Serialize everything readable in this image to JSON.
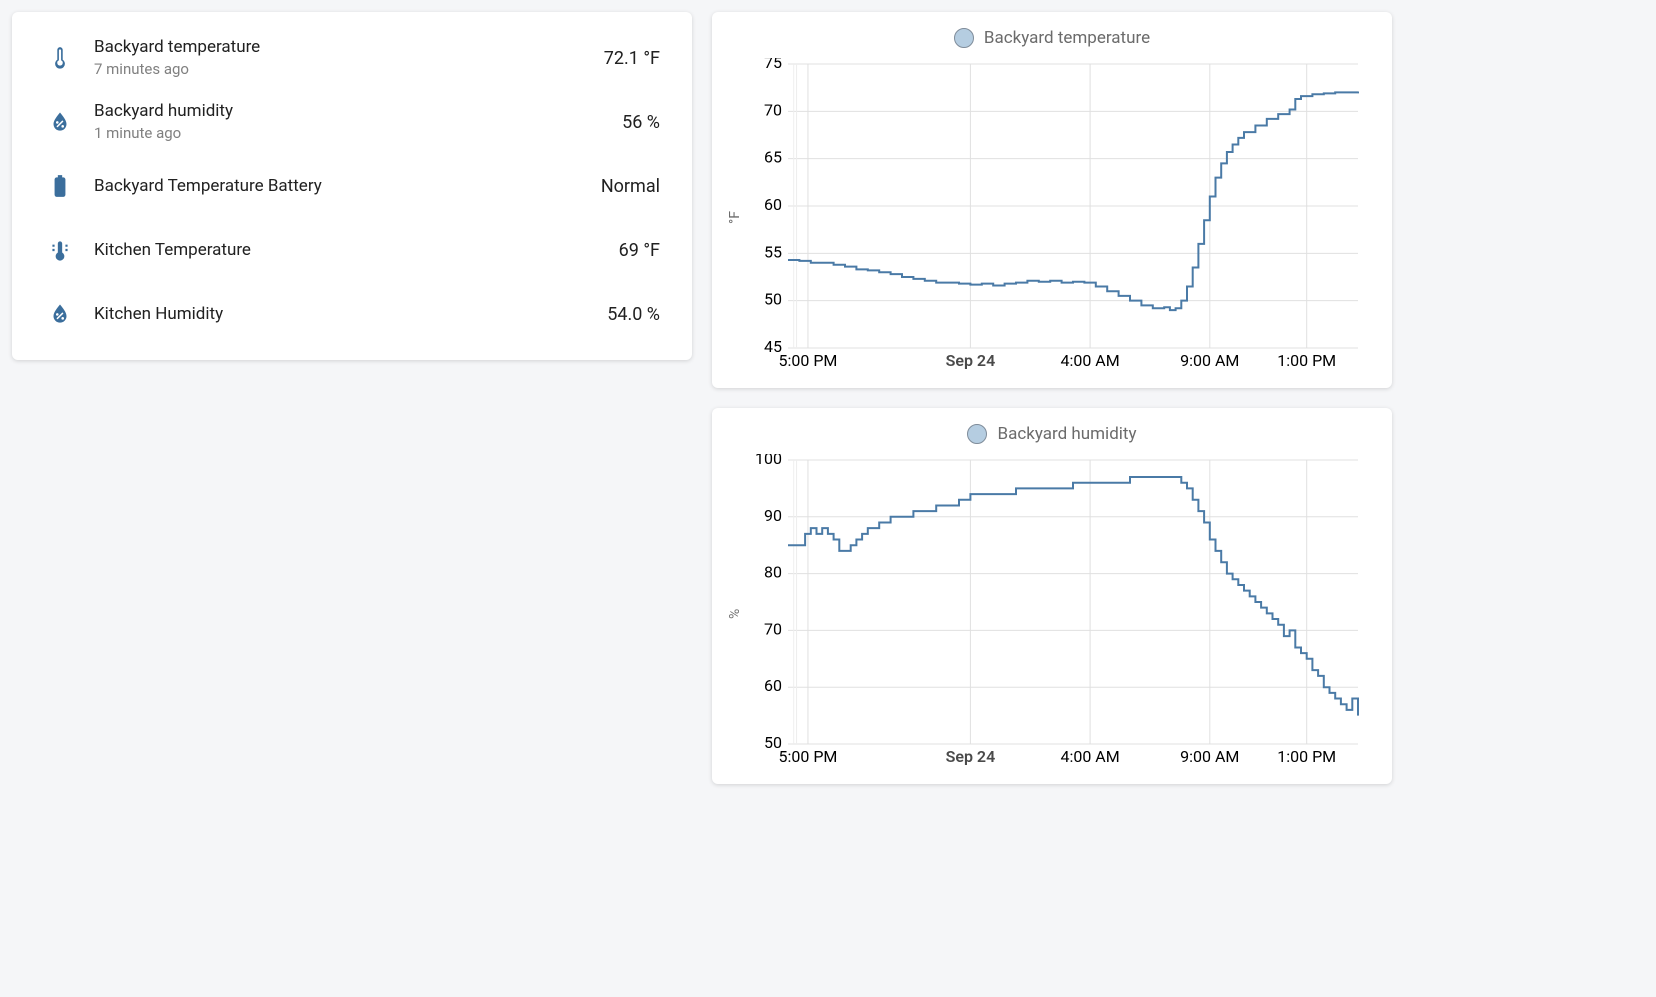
{
  "sensors": {
    "items": [
      {
        "icon": "thermometer",
        "name": "Backyard temperature",
        "sub": "7 minutes ago",
        "value": "72.1 °F"
      },
      {
        "icon": "humidity",
        "name": "Backyard humidity",
        "sub": "1 minute ago",
        "value": "56 %"
      },
      {
        "icon": "battery",
        "name": "Backyard Temperature Battery",
        "sub": "",
        "value": "Normal"
      },
      {
        "icon": "thermostat",
        "name": "Kitchen Temperature",
        "sub": "",
        "value": "69 °F"
      },
      {
        "icon": "humidity",
        "name": "Kitchen Humidity",
        "sub": "",
        "value": "54.0 %"
      }
    ]
  },
  "charts": {
    "temp": {
      "legend": "Backyard temperature",
      "ylabel": "°F"
    },
    "hum": {
      "legend": "Backyard humidity",
      "ylabel": "%"
    }
  },
  "chart_data": [
    {
      "type": "line",
      "title": "Backyard temperature",
      "ylabel": "°F",
      "xlabel": "",
      "ylim": [
        45,
        75
      ],
      "yticks": [
        45,
        50,
        55,
        60,
        65,
        70,
        75
      ],
      "xticks": [
        "5:00 PM",
        "Sep 24",
        "4:00 AM",
        "9:00 AM",
        "1:00 PM"
      ],
      "xtick_bold": [
        false,
        true,
        false,
        false,
        false
      ],
      "xtick_pos": [
        0.035,
        0.32,
        0.53,
        0.74,
        0.91
      ],
      "series": [
        {
          "name": "Backyard temperature",
          "points": [
            [
              0.0,
              54.3
            ],
            [
              0.02,
              54.2
            ],
            [
              0.04,
              54.0
            ],
            [
              0.07,
              54.0
            ],
            [
              0.08,
              53.8
            ],
            [
              0.1,
              53.6
            ],
            [
              0.12,
              53.3
            ],
            [
              0.14,
              53.2
            ],
            [
              0.16,
              53.0
            ],
            [
              0.18,
              52.8
            ],
            [
              0.2,
              52.5
            ],
            [
              0.22,
              52.3
            ],
            [
              0.24,
              52.1
            ],
            [
              0.26,
              51.9
            ],
            [
              0.28,
              51.9
            ],
            [
              0.3,
              51.8
            ],
            [
              0.32,
              51.7
            ],
            [
              0.34,
              51.8
            ],
            [
              0.36,
              51.6
            ],
            [
              0.38,
              51.8
            ],
            [
              0.4,
              51.9
            ],
            [
              0.42,
              52.1
            ],
            [
              0.44,
              52.0
            ],
            [
              0.46,
              52.1
            ],
            [
              0.48,
              51.9
            ],
            [
              0.5,
              52.0
            ],
            [
              0.52,
              51.9
            ],
            [
              0.54,
              51.5
            ],
            [
              0.56,
              51.0
            ],
            [
              0.58,
              50.5
            ],
            [
              0.6,
              50.0
            ],
            [
              0.62,
              49.5
            ],
            [
              0.64,
              49.2
            ],
            [
              0.66,
              49.3
            ],
            [
              0.67,
              49.0
            ],
            [
              0.68,
              49.2
            ],
            [
              0.69,
              50.0
            ],
            [
              0.7,
              51.5
            ],
            [
              0.71,
              53.5
            ],
            [
              0.72,
              56.0
            ],
            [
              0.73,
              58.5
            ],
            [
              0.74,
              61.0
            ],
            [
              0.75,
              63.0
            ],
            [
              0.76,
              64.5
            ],
            [
              0.77,
              65.7
            ],
            [
              0.78,
              66.5
            ],
            [
              0.79,
              67.2
            ],
            [
              0.8,
              67.8
            ],
            [
              0.82,
              68.5
            ],
            [
              0.84,
              69.2
            ],
            [
              0.86,
              69.7
            ],
            [
              0.88,
              70.2
            ],
            [
              0.89,
              71.3
            ],
            [
              0.9,
              71.6
            ],
            [
              0.92,
              71.8
            ],
            [
              0.94,
              71.9
            ],
            [
              0.96,
              72.0
            ],
            [
              0.98,
              72.0
            ],
            [
              1.0,
              72.1
            ]
          ]
        }
      ]
    },
    {
      "type": "line",
      "title": "Backyard humidity",
      "ylabel": "%",
      "xlabel": "",
      "ylim": [
        50,
        100
      ],
      "yticks": [
        50,
        60,
        70,
        80,
        90,
        100
      ],
      "xticks": [
        "5:00 PM",
        "Sep 24",
        "4:00 AM",
        "9:00 AM",
        "1:00 PM"
      ],
      "xtick_bold": [
        false,
        true,
        false,
        false,
        false
      ],
      "xtick_pos": [
        0.035,
        0.32,
        0.53,
        0.74,
        0.91
      ],
      "series": [
        {
          "name": "Backyard humidity",
          "points": [
            [
              0.0,
              85
            ],
            [
              0.02,
              85
            ],
            [
              0.03,
              87
            ],
            [
              0.04,
              88
            ],
            [
              0.05,
              87
            ],
            [
              0.06,
              88
            ],
            [
              0.07,
              87
            ],
            [
              0.08,
              86
            ],
            [
              0.09,
              84
            ],
            [
              0.1,
              84
            ],
            [
              0.11,
              85
            ],
            [
              0.12,
              86
            ],
            [
              0.13,
              87
            ],
            [
              0.14,
              88
            ],
            [
              0.16,
              89
            ],
            [
              0.18,
              90
            ],
            [
              0.2,
              90
            ],
            [
              0.22,
              91
            ],
            [
              0.24,
              91
            ],
            [
              0.26,
              92
            ],
            [
              0.28,
              92
            ],
            [
              0.3,
              93
            ],
            [
              0.32,
              94
            ],
            [
              0.34,
              94
            ],
            [
              0.36,
              94
            ],
            [
              0.38,
              94
            ],
            [
              0.4,
              95
            ],
            [
              0.42,
              95
            ],
            [
              0.44,
              95
            ],
            [
              0.46,
              95
            ],
            [
              0.48,
              95
            ],
            [
              0.5,
              96
            ],
            [
              0.52,
              96
            ],
            [
              0.54,
              96
            ],
            [
              0.56,
              96
            ],
            [
              0.58,
              96
            ],
            [
              0.6,
              97
            ],
            [
              0.62,
              97
            ],
            [
              0.64,
              97
            ],
            [
              0.66,
              97
            ],
            [
              0.68,
              97
            ],
            [
              0.69,
              96
            ],
            [
              0.7,
              95
            ],
            [
              0.71,
              93
            ],
            [
              0.72,
              91
            ],
            [
              0.73,
              89
            ],
            [
              0.74,
              86
            ],
            [
              0.75,
              84
            ],
            [
              0.76,
              82
            ],
            [
              0.77,
              80
            ],
            [
              0.78,
              79
            ],
            [
              0.79,
              78
            ],
            [
              0.8,
              77
            ],
            [
              0.81,
              76
            ],
            [
              0.82,
              75
            ],
            [
              0.83,
              74
            ],
            [
              0.84,
              73
            ],
            [
              0.85,
              72
            ],
            [
              0.86,
              71
            ],
            [
              0.87,
              69
            ],
            [
              0.88,
              70
            ],
            [
              0.89,
              67
            ],
            [
              0.9,
              66
            ],
            [
              0.91,
              65
            ],
            [
              0.92,
              63
            ],
            [
              0.93,
              62
            ],
            [
              0.94,
              60
            ],
            [
              0.95,
              59
            ],
            [
              0.96,
              58
            ],
            [
              0.97,
              57
            ],
            [
              0.98,
              56
            ],
            [
              0.99,
              58
            ],
            [
              1.0,
              55
            ]
          ]
        }
      ]
    }
  ]
}
